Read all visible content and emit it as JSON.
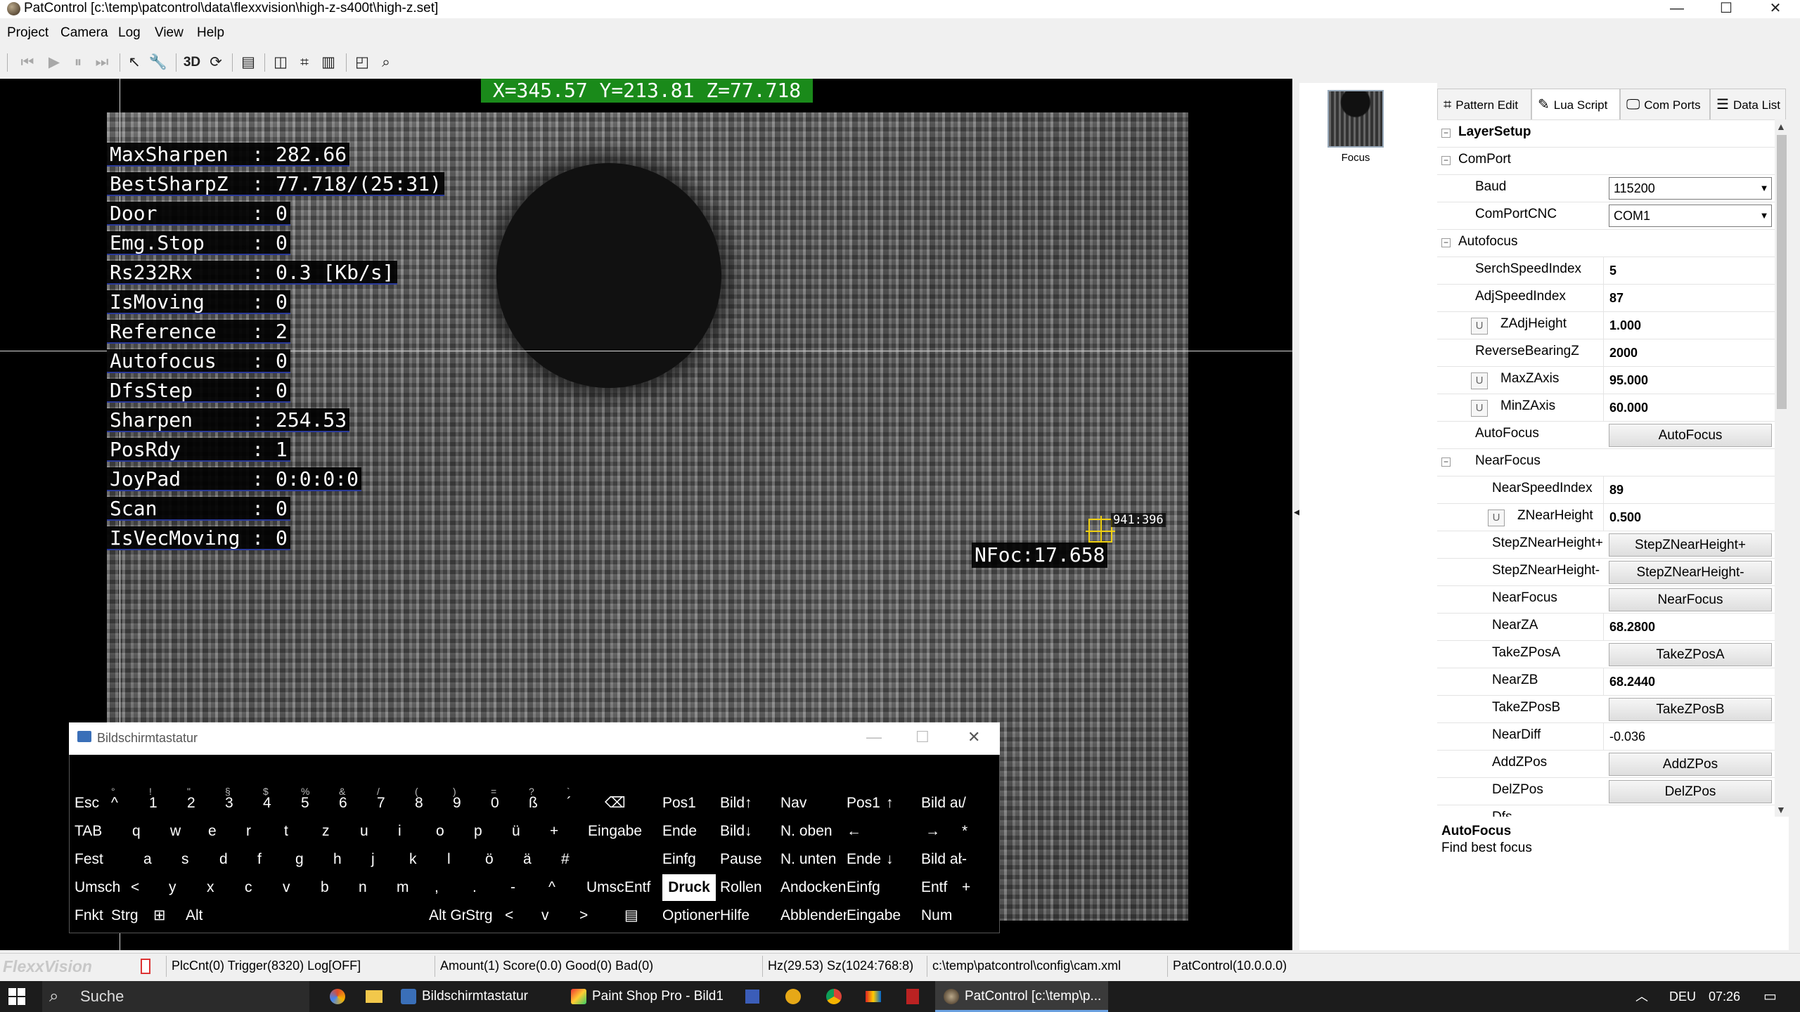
{
  "window": {
    "title": "PatControl [c:\\temp\\patcontrol\\data\\flexxvision\\high-z-s400t\\high-z.set]",
    "minimize": "—",
    "maximize": "☐",
    "close": "✕"
  },
  "menu": [
    "Project",
    "Camera",
    "Log",
    "View",
    "Help"
  ],
  "toolbar": {
    "icons": [
      "skip-back-icon",
      "play-icon",
      "pause-icon",
      "skip-forward-icon",
      "pointer-icon",
      "wrench-icon",
      "3d-icon",
      "rotate-icon",
      "frame-icon",
      "split-icon",
      "fit-icon",
      "histogram-icon",
      "select-icon",
      "zoom-icon"
    ],
    "label_3d": "3D"
  },
  "camera": {
    "coords": "X=345.57 Y=213.81 Z=77.718",
    "stats": [
      "MaxSharpen  : 282.66",
      "BestSharpZ  : 77.718/(25:31)",
      "Door        : 0",
      "Emg.Stop    : 0",
      "Rs232Rx     : 0.3 [Kb/s]",
      "IsMoving    : 0",
      "Reference   : 2",
      "Autofocus   : 0",
      "DfsStep     : 0",
      "Sharpen     : 254.53",
      "PosRdy      : 1",
      "JoyPad      : 0:0:0:0",
      "Scan        : 0",
      "IsVecMoving : 0"
    ],
    "focus_marker_label": "941:396",
    "nfoc": "NFoc:17.658"
  },
  "thumbnail": {
    "label": "Focus"
  },
  "tabs": [
    {
      "label": "Pattern Edit",
      "icon": "pattern-icon",
      "active": false
    },
    {
      "label": "Lua Script",
      "icon": "script-icon",
      "active": true
    },
    {
      "label": "Com Ports",
      "icon": "monitor-icon",
      "active": false
    },
    {
      "label": "Data List",
      "icon": "list-icon",
      "active": false
    }
  ],
  "grid": {
    "layer_setup": "LayerSetup",
    "comport": "ComPort",
    "baud_name": "Baud",
    "baud_value": "115200",
    "comportcnc_name": "ComPortCNC",
    "comportcnc_value": "COM1",
    "autofocus": "Autofocus",
    "serch_name": "SerchSpeedIndex",
    "serch_value": "5",
    "adj_name": "AdjSpeedIndex",
    "adj_value": "87",
    "zadj_name": "ZAdjHeight",
    "zadj_value": "1.000",
    "reverse_name": "ReverseBearingZ",
    "reverse_value": "2000",
    "maxz_name": "MaxZAxis",
    "maxz_value": "95.000",
    "minz_name": "MinZAxis",
    "minz_value": "60.000",
    "autofocus_name": "AutoFocus",
    "autofocus_btn": "AutoFocus",
    "nearfocus": "NearFocus",
    "nearspeed_name": "NearSpeedIndex",
    "nearspeed_value": "89",
    "znear_name": "ZNearHeight",
    "znear_value": "0.500",
    "stepplus_name": "StepZNearHeight+",
    "stepplus_btn": "StepZNearHeight+",
    "stepminus_name": "StepZNearHeight-",
    "stepminus_btn": "StepZNearHeight-",
    "nearfocus_name": "NearFocus",
    "nearfocus_btn": "NearFocus",
    "nearza_name": "NearZA",
    "nearza_value": "68.2800",
    "takea_name": "TakeZPosA",
    "takea_btn": "TakeZPosA",
    "nearzb_name": "NearZB",
    "nearzb_value": "68.2440",
    "takeb_name": "TakeZPosB",
    "takeb_btn": "TakeZPosB",
    "neardiff_name": "NearDiff",
    "neardiff_value": "-0.036",
    "addz_name": "AddZPos",
    "addz_btn": "AddZPos",
    "delz_name": "DelZPos",
    "delz_btn": "DelZPos",
    "dfs_name": "Dfs",
    "u_label": "U"
  },
  "description": {
    "title": "AutoFocus",
    "text": "Find best focus"
  },
  "status": {
    "brand": "FlexxVision",
    "plc": "PlcCnt(0) Trigger(8320) Log[OFF]",
    "amount": "Amount(1) Score(0.0) Good(0) Bad(0)",
    "hz": "Hz(29.53) Sz(1024:768:8)",
    "path": "c:\\temp\\patcontrol\\config\\cam.xml",
    "version": "PatControl(10.0.0.0)"
  },
  "osk": {
    "title": "Bildschirmtastatur",
    "row1": [
      {
        "m": "Esc"
      },
      {
        "s": "°",
        "m": "^"
      },
      {
        "s": "!",
        "m": "1"
      },
      {
        "s": "\"",
        "m": "2"
      },
      {
        "s": "§",
        "m": "3"
      },
      {
        "s": "$",
        "m": "4"
      },
      {
        "s": "%",
        "m": "5"
      },
      {
        "s": "&",
        "m": "6"
      },
      {
        "s": "/",
        "m": "7"
      },
      {
        "s": "(",
        "m": "8"
      },
      {
        "s": ")",
        "m": "9"
      },
      {
        "s": "=",
        "m": "0"
      },
      {
        "s": "?",
        "m": "ß"
      },
      {
        "s": "`",
        "m": "´"
      },
      {
        "m": "⌫"
      }
    ],
    "row2": [
      "TAB",
      "q",
      "w",
      "e",
      "r",
      "t",
      "z",
      "u",
      "i",
      "o",
      "p",
      "ü",
      "+",
      "Eingabe"
    ],
    "row3": [
      "Fest",
      "a",
      "s",
      "d",
      "f",
      "g",
      "h",
      "j",
      "k",
      "l",
      "ö",
      "ä",
      "#"
    ],
    "row4": [
      "Umsch",
      "<",
      "y",
      "x",
      "c",
      "v",
      "b",
      "n",
      "m",
      ",",
      ".",
      "-",
      "^",
      "Umsch",
      "Entf"
    ],
    "row5": [
      "Fnkt",
      "Strg",
      "⊞",
      "Alt",
      "Alt Gr",
      "Strg",
      "<",
      "v",
      ">",
      "▤"
    ],
    "nav": {
      "pos1": "Pos1",
      "bildup": "Bild↑",
      "nav": "Nav",
      "ende": "Ende",
      "bilddown": "Bild↓",
      "noben": "N. oben",
      "einfg": "Einfg",
      "pause": "Pause",
      "nunten": "N. unten",
      "druck": "Druck",
      "rollen": "Rollen",
      "andocken": "Andocken",
      "optionen": "Optionen",
      "hilfe": "Hilfe",
      "abblenden": "Abblenden"
    },
    "numpad": {
      "pos1": "Pos1",
      "up": "↑",
      "bildauf": "Bild auf",
      "div": "/",
      "left": "←",
      "right": "→",
      "mul": "*",
      "ende": "Ende",
      "down": "↓",
      "bildab": "Bild ab",
      "minus": "-",
      "einfg": "Einfg",
      "entf": "Entf",
      "plus": "+",
      "eingabe": "Eingabe",
      "num": "Num"
    }
  },
  "taskbar": {
    "search": "Suche",
    "apps": [
      "Bildschirmtastatur",
      "Paint Shop Pro - Bild1",
      "PatControl [c:\\temp\\p..."
    ],
    "lang": "DEU",
    "time": "07:26"
  }
}
